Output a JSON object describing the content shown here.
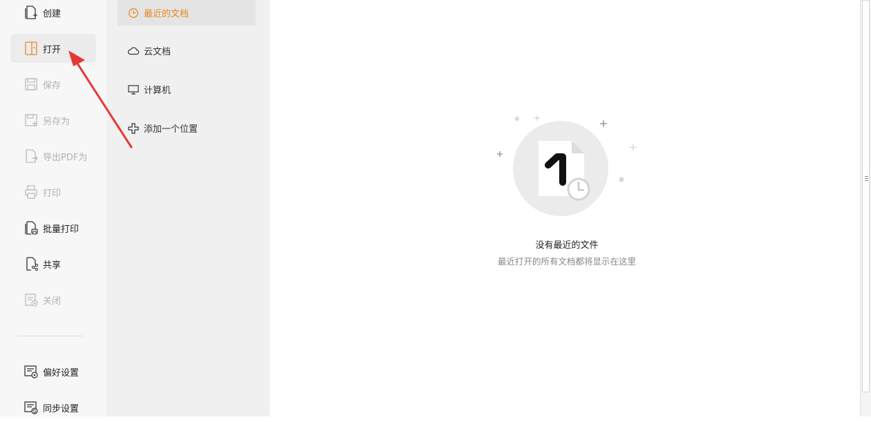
{
  "nav": {
    "items": [
      {
        "label": "创建",
        "icon": "new-document-icon"
      },
      {
        "label": "打开",
        "icon": "open-folder-icon"
      },
      {
        "label": "保存",
        "icon": "save-icon"
      },
      {
        "label": "另存为",
        "icon": "save-as-icon"
      },
      {
        "label": "导出PDF为",
        "icon": "export-pdf-icon"
      },
      {
        "label": "打印",
        "icon": "print-icon"
      },
      {
        "label": "批量打印",
        "icon": "batch-print-icon"
      },
      {
        "label": "共享",
        "icon": "share-icon"
      },
      {
        "label": "关闭",
        "icon": "close-document-icon"
      },
      {
        "label": "偏好设置",
        "icon": "preferences-icon"
      },
      {
        "label": "同步设置",
        "icon": "sync-settings-icon"
      }
    ]
  },
  "subnav": {
    "items": [
      {
        "label": "最近的文档",
        "icon": "clock-icon"
      },
      {
        "label": "云文档",
        "icon": "cloud-icon"
      },
      {
        "label": "计算机",
        "icon": "computer-icon"
      },
      {
        "label": "添加一个位置",
        "icon": "add-location-icon"
      }
    ]
  },
  "main": {
    "empty_title": "没有最近的文件",
    "empty_subtitle": "最近打开的所有文档都将显示在这里"
  },
  "colors": {
    "accent": "#e8861f",
    "annotation_arrow": "#e53935"
  }
}
